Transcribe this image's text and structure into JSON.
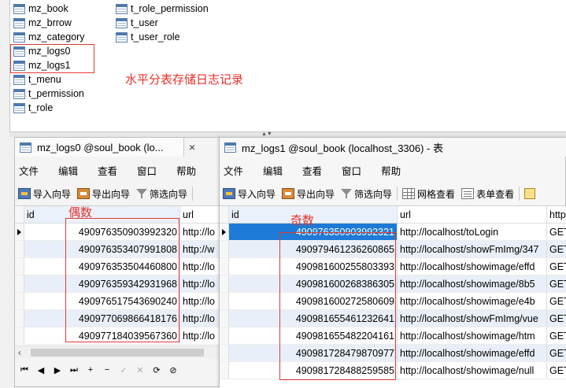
{
  "tables_col1": [
    "mz_book",
    "mz_brrow",
    "mz_category",
    "mz_logs0",
    "mz_logs1",
    "t_menu",
    "t_permission",
    "t_role"
  ],
  "tables_col2": [
    "t_role_permission",
    "t_user",
    "t_user_role"
  ],
  "annotation_main": "水平分表存储日志记录",
  "annotation_even": "偶数",
  "annotation_odd": "奇数",
  "left_pane": {
    "tab_title": "mz_logs0 @soul_book (lo...",
    "close": "×",
    "menu": [
      "文件",
      "编辑",
      "查看",
      "窗口",
      "帮助"
    ],
    "toolbar": {
      "import": "导入向导",
      "export": "导出向导",
      "filter": "筛选向导"
    },
    "columns": {
      "id": "id",
      "url": "url"
    },
    "rows": [
      {
        "id": "490976350903992320",
        "url": "http://lo"
      },
      {
        "id": "490976353407991808",
        "url": "http://w"
      },
      {
        "id": "490976353504460800",
        "url": "http://lo"
      },
      {
        "id": "490976359342931968",
        "url": "http://lo"
      },
      {
        "id": "490976517543690240",
        "url": "http://lo"
      },
      {
        "id": "490977069866418176",
        "url": "http://lo"
      },
      {
        "id": "490977184039567360",
        "url": "http://lo"
      }
    ],
    "nav": [
      "⏮",
      "◀",
      "▶",
      "⏭",
      "+",
      "−",
      "✓",
      "✕",
      "⟳",
      "⊘"
    ]
  },
  "right_pane": {
    "tab_title": "mz_logs1 @soul_book (localhost_3306) - 表",
    "menu": [
      "文件",
      "编辑",
      "查看",
      "窗口",
      "帮助"
    ],
    "toolbar": {
      "import": "导入向导",
      "export": "导出向导",
      "filter": "筛选向导",
      "grid": "网格查看",
      "form": "表单查看"
    },
    "columns": {
      "id": "id",
      "url": "url",
      "extra": "http"
    },
    "rows": [
      {
        "id": "490976350903992321",
        "url": "http://localhost/toLogin",
        "extra": "GET"
      },
      {
        "id": "490979461236260865",
        "url": "http://localhost/showFmImg/347",
        "extra": "GET"
      },
      {
        "id": "490981600255803393",
        "url": "http://localhost/showimage/effd",
        "extra": "GET"
      },
      {
        "id": "490981600268386305",
        "url": "http://localhost/showimage/8b5",
        "extra": "GET"
      },
      {
        "id": "490981600272580609",
        "url": "http://localhost/showimage/e4b",
        "extra": "GET"
      },
      {
        "id": "490981655461232641",
        "url": "http://localhost/showFmImg/vue",
        "extra": "GET"
      },
      {
        "id": "490981655482204161",
        "url": "http://localhost/showimage/htm",
        "extra": "GET"
      },
      {
        "id": "490981728479870977",
        "url": "http://localhost/showimage/effd",
        "extra": "GET"
      },
      {
        "id": "490981728488259585",
        "url": "http://localhost/showimage/null",
        "extra": "GET"
      }
    ]
  },
  "colors": {
    "annotation": "#e8302a",
    "selection": "#1e7ad6",
    "alt_row": "#e9eff8"
  }
}
